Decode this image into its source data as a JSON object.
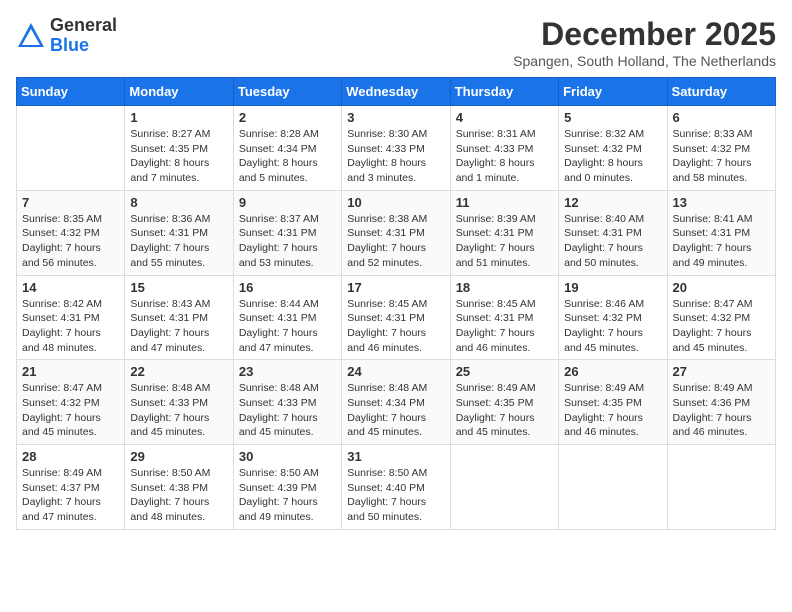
{
  "header": {
    "logo_general": "General",
    "logo_blue": "Blue",
    "month": "December 2025",
    "location": "Spangen, South Holland, The Netherlands"
  },
  "days_of_week": [
    "Sunday",
    "Monday",
    "Tuesday",
    "Wednesday",
    "Thursday",
    "Friday",
    "Saturday"
  ],
  "weeks": [
    [
      {
        "day": "",
        "info": ""
      },
      {
        "day": "1",
        "info": "Sunrise: 8:27 AM\nSunset: 4:35 PM\nDaylight: 8 hours\nand 7 minutes."
      },
      {
        "day": "2",
        "info": "Sunrise: 8:28 AM\nSunset: 4:34 PM\nDaylight: 8 hours\nand 5 minutes."
      },
      {
        "day": "3",
        "info": "Sunrise: 8:30 AM\nSunset: 4:33 PM\nDaylight: 8 hours\nand 3 minutes."
      },
      {
        "day": "4",
        "info": "Sunrise: 8:31 AM\nSunset: 4:33 PM\nDaylight: 8 hours\nand 1 minute."
      },
      {
        "day": "5",
        "info": "Sunrise: 8:32 AM\nSunset: 4:32 PM\nDaylight: 8 hours\nand 0 minutes."
      },
      {
        "day": "6",
        "info": "Sunrise: 8:33 AM\nSunset: 4:32 PM\nDaylight: 7 hours\nand 58 minutes."
      }
    ],
    [
      {
        "day": "7",
        "info": "Sunrise: 8:35 AM\nSunset: 4:32 PM\nDaylight: 7 hours\nand 56 minutes."
      },
      {
        "day": "8",
        "info": "Sunrise: 8:36 AM\nSunset: 4:31 PM\nDaylight: 7 hours\nand 55 minutes."
      },
      {
        "day": "9",
        "info": "Sunrise: 8:37 AM\nSunset: 4:31 PM\nDaylight: 7 hours\nand 53 minutes."
      },
      {
        "day": "10",
        "info": "Sunrise: 8:38 AM\nSunset: 4:31 PM\nDaylight: 7 hours\nand 52 minutes."
      },
      {
        "day": "11",
        "info": "Sunrise: 8:39 AM\nSunset: 4:31 PM\nDaylight: 7 hours\nand 51 minutes."
      },
      {
        "day": "12",
        "info": "Sunrise: 8:40 AM\nSunset: 4:31 PM\nDaylight: 7 hours\nand 50 minutes."
      },
      {
        "day": "13",
        "info": "Sunrise: 8:41 AM\nSunset: 4:31 PM\nDaylight: 7 hours\nand 49 minutes."
      }
    ],
    [
      {
        "day": "14",
        "info": "Sunrise: 8:42 AM\nSunset: 4:31 PM\nDaylight: 7 hours\nand 48 minutes."
      },
      {
        "day": "15",
        "info": "Sunrise: 8:43 AM\nSunset: 4:31 PM\nDaylight: 7 hours\nand 47 minutes."
      },
      {
        "day": "16",
        "info": "Sunrise: 8:44 AM\nSunset: 4:31 PM\nDaylight: 7 hours\nand 47 minutes."
      },
      {
        "day": "17",
        "info": "Sunrise: 8:45 AM\nSunset: 4:31 PM\nDaylight: 7 hours\nand 46 minutes."
      },
      {
        "day": "18",
        "info": "Sunrise: 8:45 AM\nSunset: 4:31 PM\nDaylight: 7 hours\nand 46 minutes."
      },
      {
        "day": "19",
        "info": "Sunrise: 8:46 AM\nSunset: 4:32 PM\nDaylight: 7 hours\nand 45 minutes."
      },
      {
        "day": "20",
        "info": "Sunrise: 8:47 AM\nSunset: 4:32 PM\nDaylight: 7 hours\nand 45 minutes."
      }
    ],
    [
      {
        "day": "21",
        "info": "Sunrise: 8:47 AM\nSunset: 4:32 PM\nDaylight: 7 hours\nand 45 minutes."
      },
      {
        "day": "22",
        "info": "Sunrise: 8:48 AM\nSunset: 4:33 PM\nDaylight: 7 hours\nand 45 minutes."
      },
      {
        "day": "23",
        "info": "Sunrise: 8:48 AM\nSunset: 4:33 PM\nDaylight: 7 hours\nand 45 minutes."
      },
      {
        "day": "24",
        "info": "Sunrise: 8:48 AM\nSunset: 4:34 PM\nDaylight: 7 hours\nand 45 minutes."
      },
      {
        "day": "25",
        "info": "Sunrise: 8:49 AM\nSunset: 4:35 PM\nDaylight: 7 hours\nand 45 minutes."
      },
      {
        "day": "26",
        "info": "Sunrise: 8:49 AM\nSunset: 4:35 PM\nDaylight: 7 hours\nand 46 minutes."
      },
      {
        "day": "27",
        "info": "Sunrise: 8:49 AM\nSunset: 4:36 PM\nDaylight: 7 hours\nand 46 minutes."
      }
    ],
    [
      {
        "day": "28",
        "info": "Sunrise: 8:49 AM\nSunset: 4:37 PM\nDaylight: 7 hours\nand 47 minutes."
      },
      {
        "day": "29",
        "info": "Sunrise: 8:50 AM\nSunset: 4:38 PM\nDaylight: 7 hours\nand 48 minutes."
      },
      {
        "day": "30",
        "info": "Sunrise: 8:50 AM\nSunset: 4:39 PM\nDaylight: 7 hours\nand 49 minutes."
      },
      {
        "day": "31",
        "info": "Sunrise: 8:50 AM\nSunset: 4:40 PM\nDaylight: 7 hours\nand 50 minutes."
      },
      {
        "day": "",
        "info": ""
      },
      {
        "day": "",
        "info": ""
      },
      {
        "day": "",
        "info": ""
      }
    ]
  ]
}
